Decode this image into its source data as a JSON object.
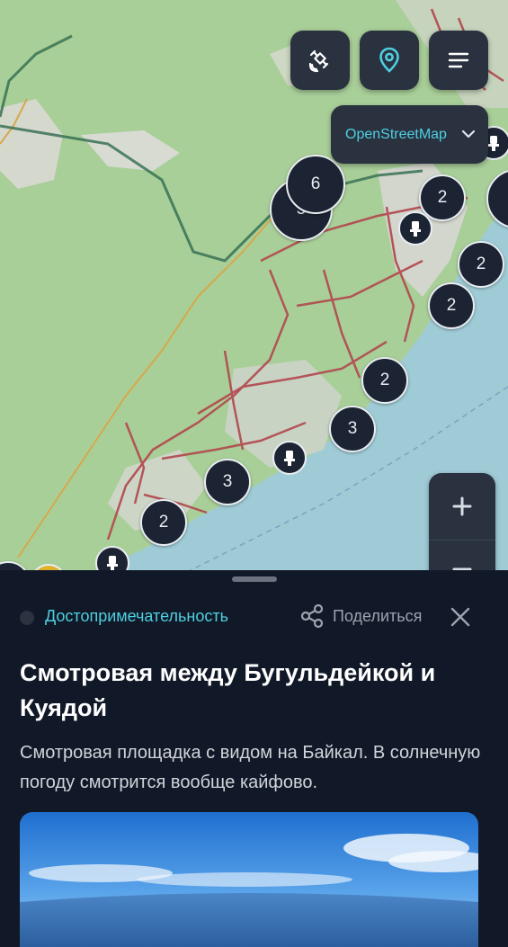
{
  "map": {
    "layer_label": "OpenStreetMap",
    "controls": {
      "satellite_icon": "satellite-icon",
      "location_icon": "map-pin-icon",
      "menu_icon": "menu-icon",
      "zoom_in_icon": "plus-icon",
      "zoom_out_icon": "minus-icon"
    },
    "clusters": [
      {
        "count": "6"
      },
      {
        "count": "5"
      },
      {
        "count": "2"
      },
      {
        "count": "2"
      },
      {
        "count": "2"
      },
      {
        "count": "2"
      },
      {
        "count": "3"
      },
      {
        "count": "3"
      },
      {
        "count": "2"
      }
    ],
    "colors": {
      "land": "#a8cf98",
      "urban": "#d6d6cf",
      "water": "#9ecbd6",
      "road": "#b0484c",
      "accent": "#4ecfe0"
    }
  },
  "place": {
    "category": "Достопримечательность",
    "share_label": "Поделиться",
    "title": "Смотровая между Бугульдейкой и Куядой",
    "description": "Смотровая площадка с видом на Байкал. В солнечную погоду смотрится вообще кайфово."
  }
}
